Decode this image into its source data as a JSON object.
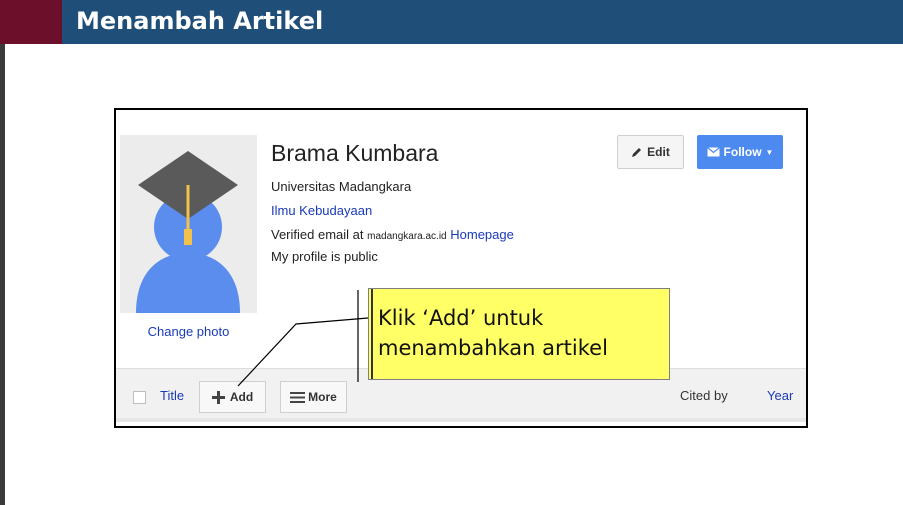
{
  "slide": {
    "title": "Menambah Artikel",
    "accent_color": "#6b0f2a",
    "header_color": "#1f4e79"
  },
  "profile": {
    "name": "Brama Kumbara",
    "affiliation": "Universitas Madangkara",
    "interest": "Ilmu Kebudayaan",
    "verified_prefix": "Verified email at",
    "verified_domain": "madangkara.ac.id",
    "homepage_label": "Homepage",
    "public_status": "My profile is public",
    "change_photo_label": "Change photo",
    "avatar_icon": "graduate-avatar-icon"
  },
  "actions": {
    "edit_label": "Edit",
    "edit_icon": "pencil-icon",
    "follow_label": "Follow",
    "follow_icon": "envelope-icon",
    "follow_color": "#4d8af0"
  },
  "toolbar": {
    "title_label": "Title",
    "add_label": "Add",
    "add_icon": "plus-icon",
    "more_label": "More",
    "more_icon": "menu-lines-icon",
    "cited_by_label": "Cited by",
    "year_label": "Year"
  },
  "callout": {
    "line1": "Klik ‘Add’ untuk",
    "line2": "menambahkan artikel",
    "color": "#ffff66"
  }
}
